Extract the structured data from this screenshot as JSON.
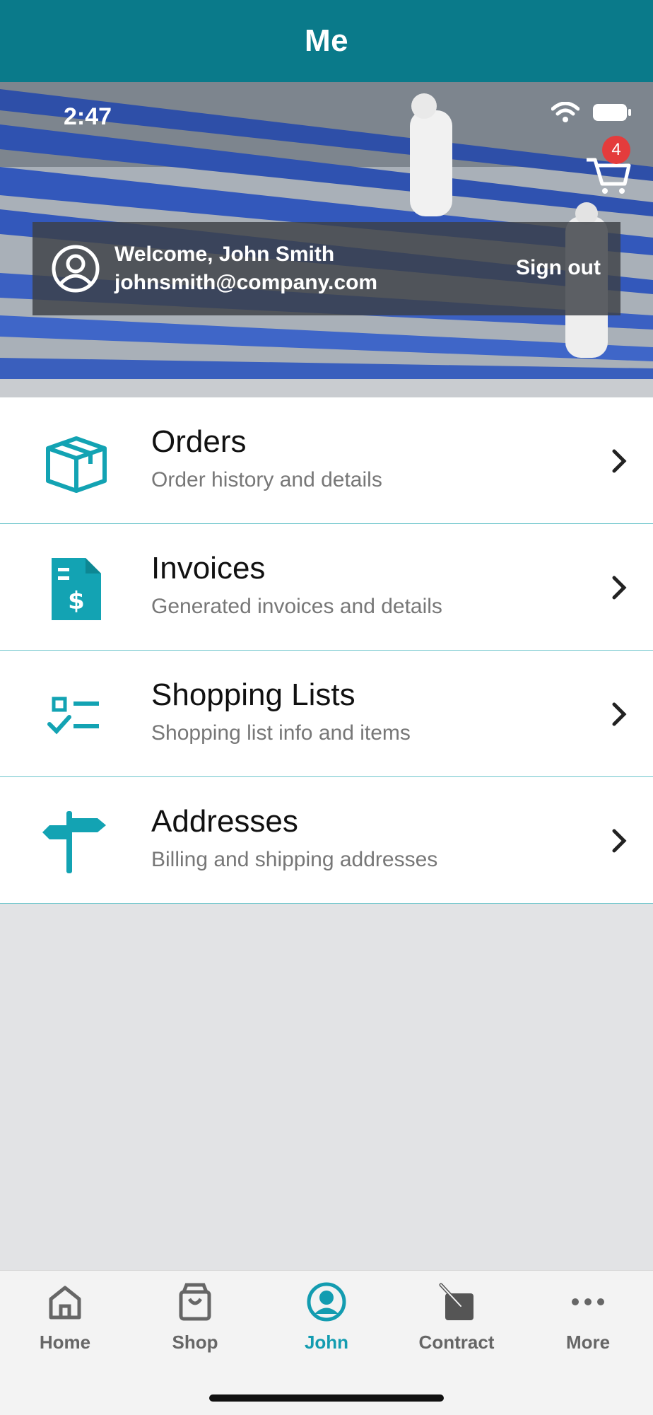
{
  "header": {
    "title": "Me"
  },
  "status": {
    "time": "2:47"
  },
  "cart": {
    "badge_count": "4"
  },
  "welcome": {
    "greeting": "Welcome, John Smith",
    "email": "johnsmith@company.com",
    "sign_out": "Sign out"
  },
  "menu": [
    {
      "title": "Orders",
      "subtitle": " Order history and details",
      "icon": "package-icon"
    },
    {
      "title": "Invoices",
      "subtitle": "Generated invoices and details",
      "icon": "invoice-icon"
    },
    {
      "title": "Shopping Lists",
      "subtitle": "Shopping list info and items",
      "icon": "checklist-icon"
    },
    {
      "title": "Addresses",
      "subtitle": "Billing and shipping addresses",
      "icon": "signpost-icon"
    }
  ],
  "tabs": [
    {
      "label": "Home",
      "icon": "home-icon",
      "active": false
    },
    {
      "label": "Shop",
      "icon": "shopping-bag-icon",
      "active": false
    },
    {
      "label": "John",
      "icon": "user-icon",
      "active": true
    },
    {
      "label": "Contract",
      "icon": "contract-icon",
      "active": false
    },
    {
      "label": "More",
      "icon": "more-icon",
      "active": false
    }
  ],
  "colors": {
    "accent": "#0a7a8a",
    "icon_teal": "#13a3b3",
    "badge": "#e43c3c"
  }
}
